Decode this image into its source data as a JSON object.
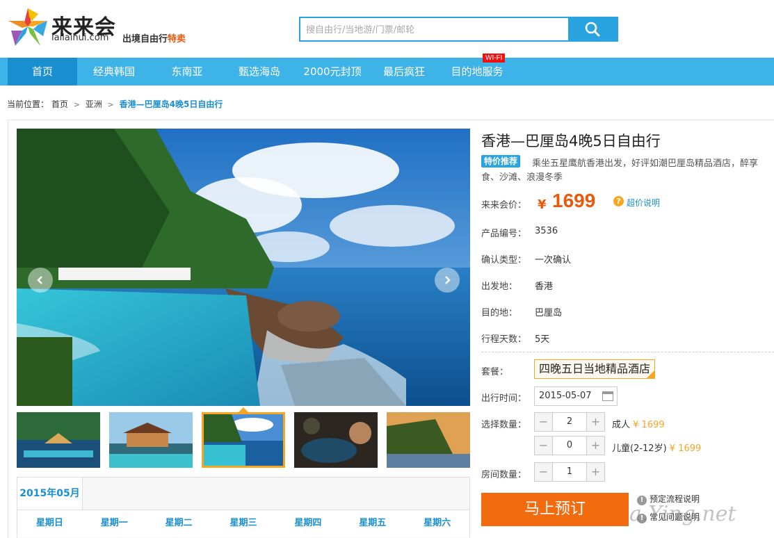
{
  "header": {
    "brand": "来来会",
    "domain": "lailaihui.com",
    "slogan": "出境自由行",
    "slogan_hot": "特卖",
    "search_placeholder": "搜自由行/当地游/门票/邮轮"
  },
  "nav": {
    "items": [
      {
        "label": "首页"
      },
      {
        "label": "经典韩国"
      },
      {
        "label": "东南亚"
      },
      {
        "label": "甄选海岛"
      },
      {
        "label": "2000元封顶"
      },
      {
        "label": "最后疯狂"
      },
      {
        "label": "目的地服务"
      }
    ],
    "wifi_badge": "WI-FI"
  },
  "breadcrumb": {
    "prefix": "当前位置：",
    "home": "首页",
    "sep": ">",
    "level1": "亚洲",
    "current": "香港—巴厘岛4晚5日自由行"
  },
  "product": {
    "title": "香港—巴厘岛4晚5日自由行",
    "tag": "特价推荐",
    "desc_line1": "乘坐五星鹰航香港出发，好评如潮巴厘岛精品酒店，醉享",
    "desc_line2": "食、沙滩、浪漫冬季",
    "price_label": "来来会价：",
    "price_currency": "¥",
    "price": "1699",
    "price_help": "超价说明",
    "fields": [
      {
        "label": "产品编号：",
        "value": "3536"
      },
      {
        "label": "确认类型：",
        "value": "一次确认"
      },
      {
        "label": "出发地：",
        "value": "香港"
      },
      {
        "label": "目的地：",
        "value": "巴厘岛"
      },
      {
        "label": "行程天数：",
        "value": "5天"
      }
    ],
    "package_label": "套餐：",
    "package_value": "四晚五日当地精品酒店",
    "date_label": "出行时间：",
    "date_value": "2015-05-07",
    "qty_label": "选择数量：",
    "adult_qty": "2",
    "adult_label": "成人",
    "adult_price": "¥ 1699",
    "child_qty": "0",
    "child_label": "儿童(2-12岁)",
    "child_price": "¥ 1699",
    "room_label": "房间数量：",
    "room_qty": "1",
    "book_button": "马上预订",
    "info1": "预定流程说明",
    "info2": "常见问题说明",
    "watermark": "a.Ying.net"
  },
  "calendar": {
    "month": "2015年05月",
    "weekdays": [
      "星期日",
      "星期一",
      "星期二",
      "星期三",
      "星期四",
      "星期五",
      "星期六"
    ]
  },
  "colors": {
    "accent": "#3eb3e8",
    "nav_active": "#1a8fd0",
    "price": "#e8590c",
    "book": "#f26b0f"
  }
}
